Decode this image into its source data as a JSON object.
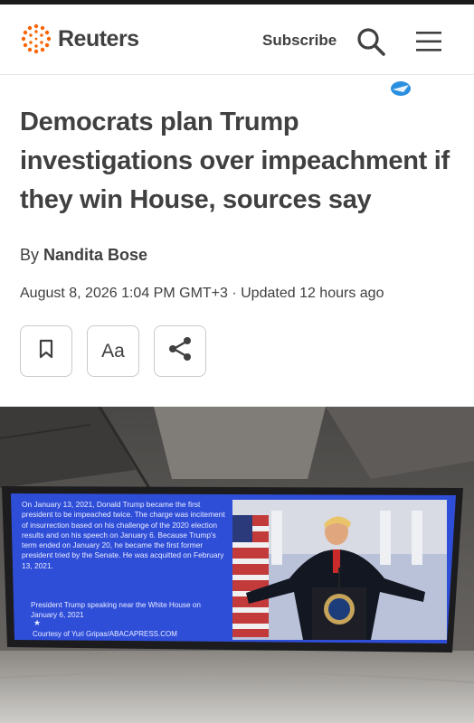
{
  "header": {
    "brand": "Reuters",
    "subscribe_label": "Subscribe",
    "logo_icon": "reuters-dot-logo-icon",
    "search_icon": "search-icon",
    "menu_icon": "hamburger-menu-icon"
  },
  "article": {
    "headline": "Democrats plan Trump investigations over impeachment if they win House, sources say",
    "byline_prefix": "By",
    "author": "Nandita Bose",
    "dateline": "August 8, 2026 1:04 PM GMT+3 · Updated 12 hours ago"
  },
  "tools": {
    "bookmark_icon": "bookmark-icon",
    "text_size_label": "Aa",
    "share_icon": "share-icon"
  },
  "photo": {
    "screen_text": "On January 13, 2021, Donald Trump became the first president to be impeached twice. The charge was incitement of insurrection based on his challenge of the 2020 election results and on his speech on January 6. Because Trump's term ended on January 20, he became the first former president tried by the Senate. He was acquitted on February 13, 2021.",
    "screen_caption": "President Trump speaking near the White House on January 6, 2021",
    "screen_star": "★",
    "screen_credit": "Courtesy of Yuri Gripas/ABACAPRESS.COM"
  },
  "colors": {
    "text": "#404040",
    "brand_orange": "#fa6400",
    "screen_blue": "#2f4ed8",
    "border": "#c9c9c9"
  }
}
